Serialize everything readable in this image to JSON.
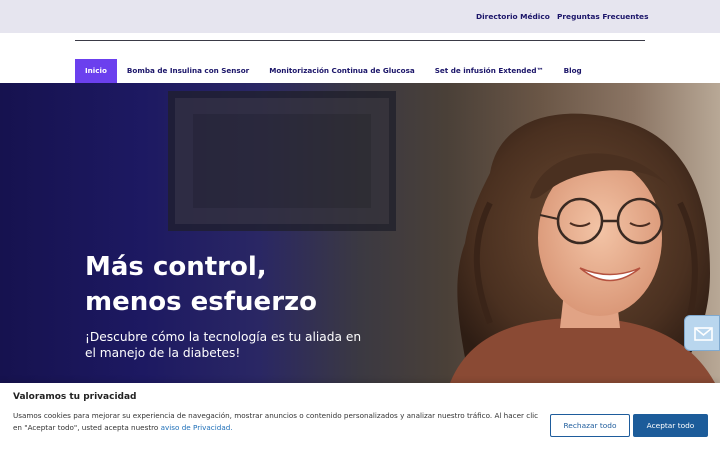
{
  "topbar": {
    "links": [
      "Directorio Médico",
      "Preguntas Frecuentes"
    ]
  },
  "nav": {
    "items": [
      "Inicio",
      "Bomba de Insulina con Sensor",
      "Monitorización Continua de Glucosa",
      "Set de infusión Extended™",
      "Blog"
    ],
    "active": "Inicio"
  },
  "hero": {
    "title_line1": "Más control,",
    "title_line2": "menos esfuerzo",
    "subtitle": "¡Descubre cómo la tecnología es tu aliada en el manejo de la diabetes!",
    "photo": "smiling-woman-with-glasses"
  },
  "floating": {
    "icon": "mail-icon"
  },
  "cookie": {
    "title": "Valoramos tu privacidad",
    "text": "Usamos cookies para mejorar su experiencia de navegación, mostrar anuncios o contenido personalizados y analizar nuestro tráfico. Al hacer clic en \"Aceptar todo\", usted acepta nuestro",
    "link": "aviso de Privacidad.",
    "reject_label": "Rechazar todo",
    "accept_label": "Aceptar todo"
  },
  "colors": {
    "brand_navy": "#1b1569",
    "active_nav": "#6b40ee",
    "accept_button": "#1c5c9a"
  }
}
